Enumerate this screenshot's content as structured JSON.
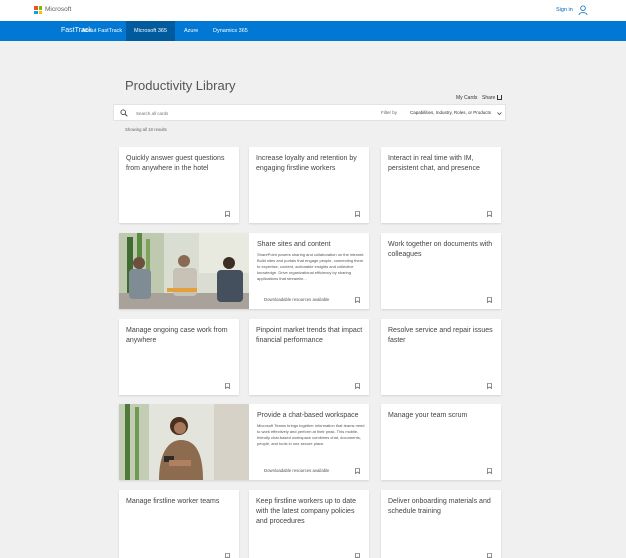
{
  "header": {
    "brand": "Microsoft",
    "sign_in": "Sign in"
  },
  "nav": {
    "brand": "FastTrack",
    "links": [
      "About FastTrack",
      "Microsoft 365",
      "Azure",
      "Dynamics 365"
    ],
    "active": "Microsoft 365"
  },
  "page": {
    "title": "Productivity Library",
    "my_cards": "My Cards",
    "share": "Share"
  },
  "search": {
    "placeholder": "Search all cards",
    "filter_label": "Filter by",
    "filter_value": "Capabilities, Industry, Roles, or Products"
  },
  "results_text": "Showing all 18 results",
  "colors": {
    "nav_blue": "#0078d4",
    "nav_active": "#005a9e",
    "ms_red": "#f25022",
    "ms_green": "#7fba00",
    "ms_blue": "#00a4ef",
    "ms_yellow": "#ffb900"
  },
  "cards": [
    {
      "title": "Quickly answer guest questions from anywhere in the hotel"
    },
    {
      "title": "Increase loyalty and retention by engaging firstline workers"
    },
    {
      "title": "Interact in real time with IM, persistent chat, and presence"
    },
    {
      "title": "Share sites and content",
      "desc": "SharePoint powers sharing and collaboration on the intranet. Build sites and portals that engage people, connecting them to expertise, content, actionable insights and collective knowledge. Drive organizational efficiency by sharing applications that streamlin...",
      "footer": "Downloadable resources available"
    },
    {
      "title": "Work together on documents with colleagues"
    },
    {
      "title": "Manage ongoing case work from anywhere"
    },
    {
      "title": "Pinpoint market trends that impact financial performance"
    },
    {
      "title": "Resolve service and repair issues faster"
    },
    {
      "title": "Provide a chat-based workspace",
      "desc": "Microsoft Teams brings together information that teams need to work effectively and perform at their peak. This mobile-friendly chat-based workspace combines chat, documents, people, and tools in one secure place.",
      "footer": "Downloadable resources available"
    },
    {
      "title": "Manage your team scrum"
    },
    {
      "title": "Manage firstline worker teams"
    },
    {
      "title": "Keep firstline workers up to date with the latest company policies and procedures"
    },
    {
      "title": "Deliver onboarding materials and schedule training"
    }
  ]
}
